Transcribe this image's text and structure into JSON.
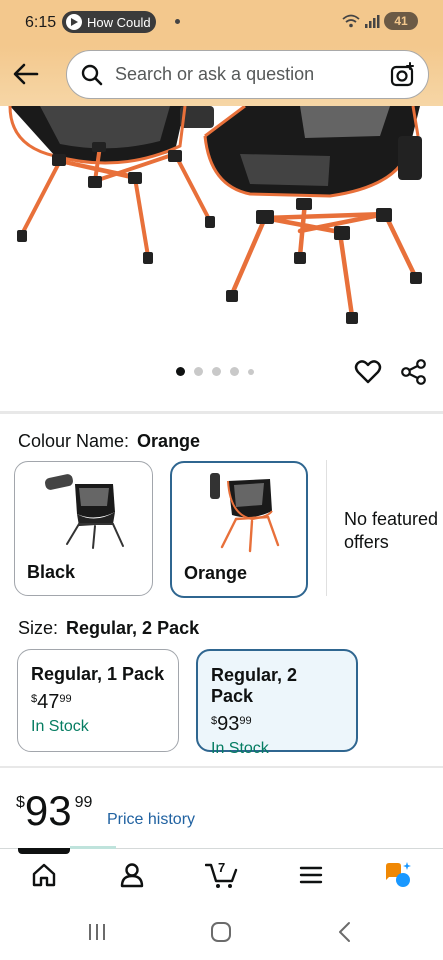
{
  "status_bar": {
    "time": "6:15",
    "notification_pill": "How Could",
    "battery": "41"
  },
  "search": {
    "placeholder": "Search or ask a question"
  },
  "carousel": {
    "total": 5,
    "active": 1
  },
  "colour": {
    "label": "Colour Name:",
    "selected": "Orange",
    "options": [
      {
        "name": "Black",
        "selected": false
      },
      {
        "name": "Orange",
        "selected": true
      }
    ],
    "no_offers": "No featured offers"
  },
  "size": {
    "label": "Size:",
    "selected": "Regular, 2 Pack",
    "options": [
      {
        "title": "Regular, 1 Pack",
        "symbol": "$",
        "whole": "47",
        "cents": "99",
        "stock": "In Stock",
        "selected": false
      },
      {
        "title": "Regular, 2 Pack",
        "symbol": "$",
        "whole": "93",
        "cents": "99",
        "stock": "In Stock",
        "selected": true
      }
    ]
  },
  "price": {
    "symbol": "$",
    "whole": "93",
    "cents": "99",
    "history_link": "Price history"
  },
  "bottom_nav": {
    "cart_count": "7",
    "items": [
      "home-icon",
      "account-icon",
      "cart-icon",
      "menu-icon",
      "rufus-assistant-icon"
    ]
  },
  "colors": {
    "header_bg": "#f3c88d",
    "selected_border": "#2f6690",
    "selected_bg": "#edf6fb",
    "in_stock": "#067d62",
    "link": "#2162a1",
    "chair_frame": "#e8703a"
  }
}
